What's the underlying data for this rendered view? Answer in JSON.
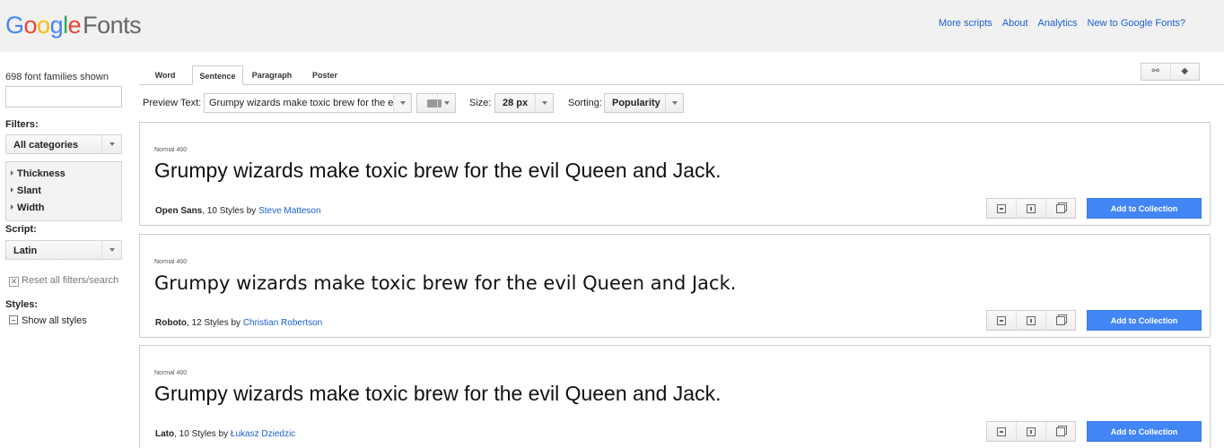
{
  "header": {
    "logo": {
      "G": "G",
      "o1": "o",
      "o2": "o",
      "g": "g",
      "l": "l",
      "e": "e",
      "fonts": "Fonts"
    },
    "nav": [
      "More scripts",
      "About",
      "Analytics",
      "New to Google Fonts?"
    ]
  },
  "sidebar": {
    "count": "698 font families shown",
    "search_value": "",
    "filters_label": "Filters:",
    "category": "All categories",
    "filter_items": [
      "Thickness",
      "Slant",
      "Width"
    ],
    "script_label": "Script:",
    "script": "Latin",
    "reset": "Reset all filters/search",
    "styles_label": "Styles:",
    "show_all": "Show all styles"
  },
  "tabs": [
    "Word",
    "Sentence",
    "Paragraph",
    "Poster"
  ],
  "active_tab": "Sentence",
  "top_icons": [
    "link-icon",
    "collapse-icon"
  ],
  "controls": {
    "preview_label": "Preview Text:",
    "preview_value": "Grumpy wizards make toxic brew for the evil Queen and Jack.",
    "size_label": "Size:",
    "size_value": "28 px",
    "sorting_label": "Sorting:",
    "sorting_value": "Popularity"
  },
  "cards": [
    {
      "style": "Normal 400",
      "sample": "Grumpy wizards make toxic brew for the evil Queen and Jack.",
      "family": "Open Sans",
      "styles": ", 10 Styles by ",
      "author": "Steve Matteson",
      "add": "Add to Collection",
      "font": "Liberation Sans"
    },
    {
      "style": "Normal 400",
      "sample": "Grumpy wizards make toxic brew for the evil Queen and Jack.",
      "family": "Roboto",
      "styles": ", 12 Styles by ",
      "author": "Christian Robertson",
      "add": "Add to Collection",
      "font": "DejaVu Sans"
    },
    {
      "style": "Normal 400",
      "sample": "Grumpy wizards make toxic brew for the evil Queen and Jack.",
      "family": "Lato",
      "styles": ", 10 Styles by ",
      "author": "Łukasz Dziedzic",
      "add": "Add to Collection",
      "font": "Liberation Sans"
    }
  ],
  "colors": {
    "accent": "#4285f4",
    "link": "#1a5fc9",
    "header_bg": "#f1f1f1"
  }
}
